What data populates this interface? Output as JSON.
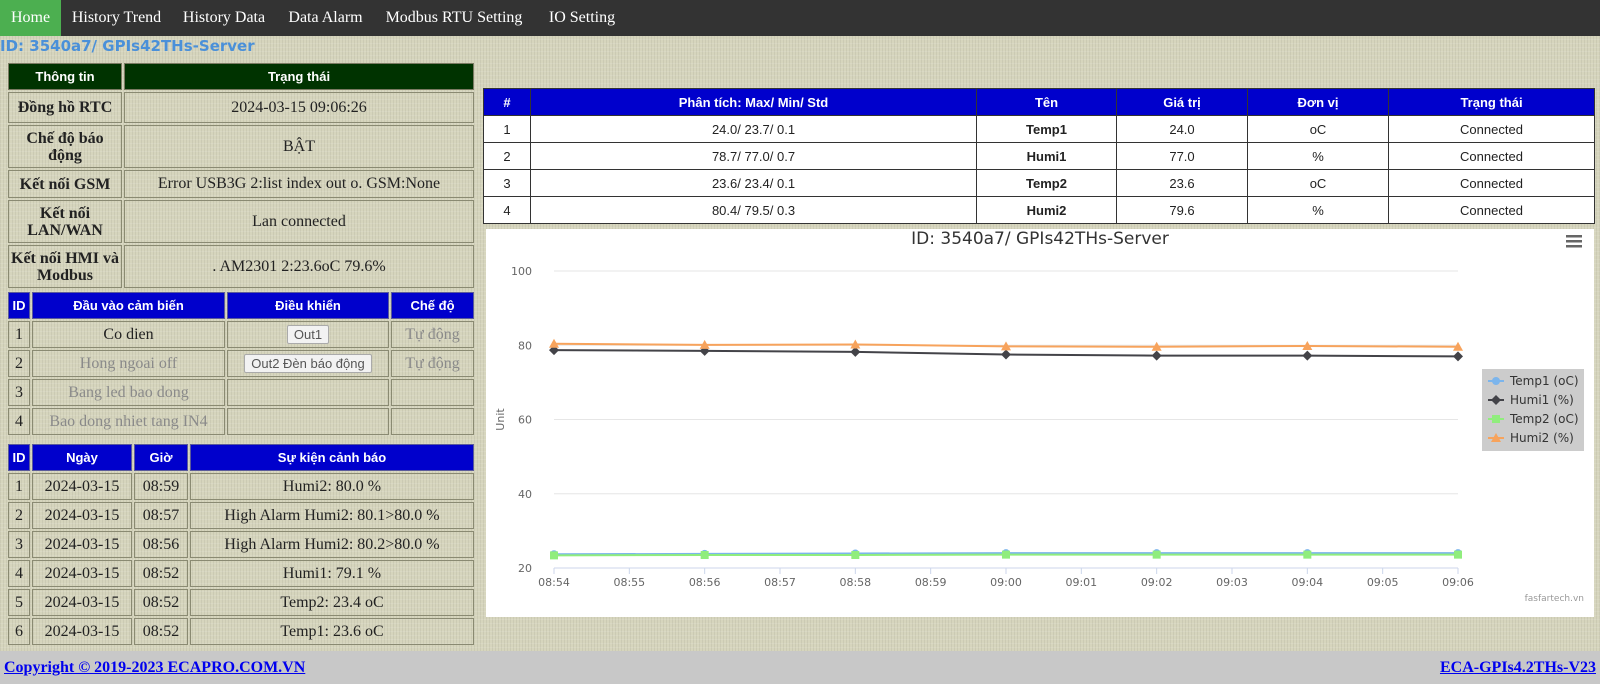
{
  "nav": {
    "items": [
      {
        "label": "Home"
      },
      {
        "label": "History Trend"
      },
      {
        "label": "History Data"
      },
      {
        "label": "Data Alarm"
      },
      {
        "label": "Modbus RTU Setting"
      },
      {
        "label": "IO Setting"
      }
    ]
  },
  "page": {
    "id": "ID: 3540a7/ GPIs42THs-Server"
  },
  "info": {
    "headers": [
      "Thông tin",
      "Trạng thái"
    ],
    "rows": [
      {
        "label": "Đồng hồ RTC",
        "value": "2024-03-15 09:06:26"
      },
      {
        "label": "Chế độ báo động",
        "value": "BẬT"
      },
      {
        "label": "Kết nối GSM",
        "value": "Error USB3G 2:list index out o. GSM:None"
      },
      {
        "label": "Kết nối LAN/WAN",
        "value": "Lan connected"
      },
      {
        "label": "Kết nối HMI và Modbus",
        "value": ". AM2301 2:23.6oC 79.6%"
      }
    ]
  },
  "control": {
    "headers": [
      "ID",
      "Đầu vào cảm biến",
      "Điều khiển",
      "Chế độ"
    ],
    "rows": [
      {
        "id": "1",
        "input": "Co dien",
        "button": "Out1",
        "mode": "Tự động"
      },
      {
        "id": "2",
        "input": "Hong ngoai off",
        "button": "Out2 Đèn báo động",
        "mode": "Tự động"
      },
      {
        "id": "3",
        "input": "Bang led bao dong",
        "button": "",
        "mode": ""
      },
      {
        "id": "4",
        "input": "Bao dong nhiet tang IN4",
        "button": "",
        "mode": ""
      }
    ]
  },
  "alarms": {
    "headers": [
      "ID",
      "Ngày",
      "Giờ",
      "Sự kiện cảnh báo"
    ],
    "rows": [
      {
        "id": "1",
        "date": "2024-03-15",
        "time": "08:59",
        "event": "Humi2: 80.0 %"
      },
      {
        "id": "2",
        "date": "2024-03-15",
        "time": "08:57",
        "event": "High Alarm Humi2: 80.1>80.0 %"
      },
      {
        "id": "3",
        "date": "2024-03-15",
        "time": "08:56",
        "event": "High Alarm Humi2: 80.2>80.0 %"
      },
      {
        "id": "4",
        "date": "2024-03-15",
        "time": "08:52",
        "event": "Humi1: 79.1 %"
      },
      {
        "id": "5",
        "date": "2024-03-15",
        "time": "08:52",
        "event": "Temp2: 23.4 oC"
      },
      {
        "id": "6",
        "date": "2024-03-15",
        "time": "08:52",
        "event": "Temp1: 23.6 oC"
      }
    ]
  },
  "measurements": {
    "headers": [
      "#",
      "Phân tích: Max/ Min/ Std",
      "Tên",
      "Giá trị",
      "Đơn vị",
      "Trạng thái"
    ],
    "rows": [
      {
        "n": "1",
        "stats": "24.0/ 23.7/ 0.1",
        "name": "Temp1",
        "value": "24.0",
        "unit": "oC",
        "status": "Connected"
      },
      {
        "n": "2",
        "stats": "78.7/ 77.0/ 0.7",
        "name": "Humi1",
        "value": "77.0",
        "unit": "%",
        "status": "Connected"
      },
      {
        "n": "3",
        "stats": "23.6/ 23.4/ 0.1",
        "name": "Temp2",
        "value": "23.6",
        "unit": "oC",
        "status": "Connected"
      },
      {
        "n": "4",
        "stats": "80.4/ 79.5/ 0.3",
        "name": "Humi2",
        "value": "79.6",
        "unit": "%",
        "status": "Connected"
      }
    ]
  },
  "chart_data": {
    "type": "line",
    "title": "ID: 3540a7/ GPIs42THs-Server",
    "ylabel": "Unit",
    "xlabel": "",
    "x_ticks": [
      "08:54",
      "08:55",
      "08:56",
      "08:57",
      "08:58",
      "08:59",
      "09:00",
      "09:01",
      "09:02",
      "09:03",
      "09:04",
      "09:05",
      "09:06"
    ],
    "x_points": [
      "08:54",
      "08:56",
      "08:58",
      "09:00",
      "09:02",
      "09:04",
      "09:06"
    ],
    "ylim": [
      20,
      100
    ],
    "y_ticks": [
      20,
      40,
      60,
      80,
      100
    ],
    "grid": true,
    "legend": "right",
    "credits": "fasfartech.vn",
    "menu_icon": "hamburger-icon",
    "series": [
      {
        "name": "Temp1 (oC)",
        "color": "#7cb5ec",
        "marker": "circle",
        "values": [
          23.7,
          23.8,
          23.9,
          24.0,
          24.0,
          24.0,
          24.0
        ]
      },
      {
        "name": "Humi1 (%)",
        "color": "#434348",
        "marker": "diamond",
        "values": [
          78.7,
          78.5,
          78.2,
          77.5,
          77.2,
          77.2,
          77.0
        ]
      },
      {
        "name": "Temp2 (oC)",
        "color": "#90ed7d",
        "marker": "square",
        "values": [
          23.4,
          23.5,
          23.5,
          23.6,
          23.6,
          23.6,
          23.6
        ]
      },
      {
        "name": "Humi2 (%)",
        "color": "#f7a35c",
        "marker": "triangle",
        "values": [
          80.4,
          80.1,
          80.2,
          79.7,
          79.6,
          79.8,
          79.6
        ]
      }
    ]
  },
  "footer": {
    "copyright": "Copyright © 2019-2023 ECAPRO.COM.VN",
    "version": "ECA-GPIs4.2THs-V23"
  }
}
